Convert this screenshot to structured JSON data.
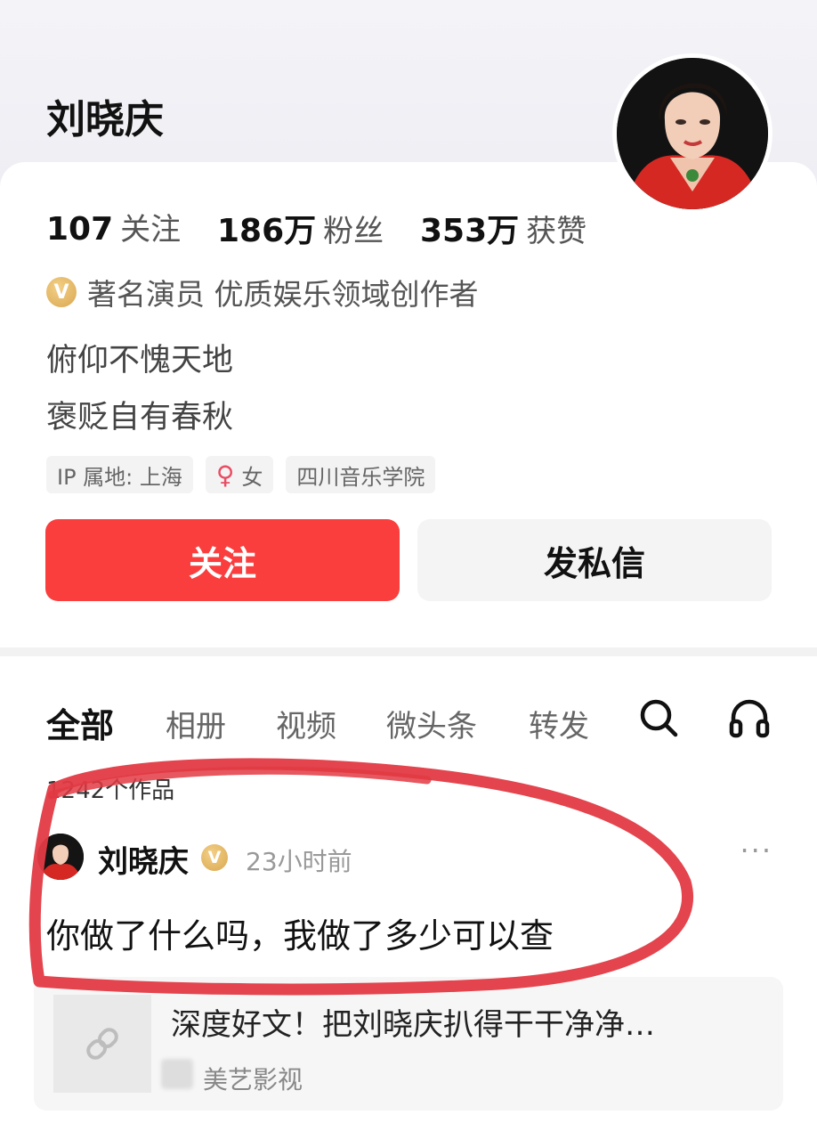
{
  "profile": {
    "name": "刘晓庆",
    "stats": [
      {
        "value": "107",
        "label": "关注"
      },
      {
        "value": "186万",
        "label": "粉丝"
      },
      {
        "value": "353万",
        "label": "获赞"
      }
    ],
    "verification_text": "著名演员 优质娱乐领域创作者",
    "verified_badge": "V",
    "bio_lines": [
      "俯仰不愧天地",
      "褒贬自有春秋"
    ],
    "tags": [
      {
        "text": "IP 属地: 上海"
      },
      {
        "icon": "♀",
        "text": "女"
      },
      {
        "text": "四川音乐学院"
      }
    ],
    "follow_label": "关注",
    "message_label": "发私信"
  },
  "tabs": [
    {
      "label": "全部",
      "active": true
    },
    {
      "label": "相册"
    },
    {
      "label": "视频"
    },
    {
      "label": "微头条"
    },
    {
      "label": "转发"
    }
  ],
  "works_count": "1242个作品",
  "post": {
    "author": "刘晓庆",
    "badge": "V",
    "time": "23小时前",
    "more": "···",
    "text": "你做了什么吗，我做了多少可以查",
    "link": {
      "title": "深度好文！把刘晓庆扒得干干净净…",
      "source": "美艺影视"
    }
  },
  "colors": {
    "follow_button": "#fa3e3e",
    "annotation_stroke": "#e23a43"
  }
}
